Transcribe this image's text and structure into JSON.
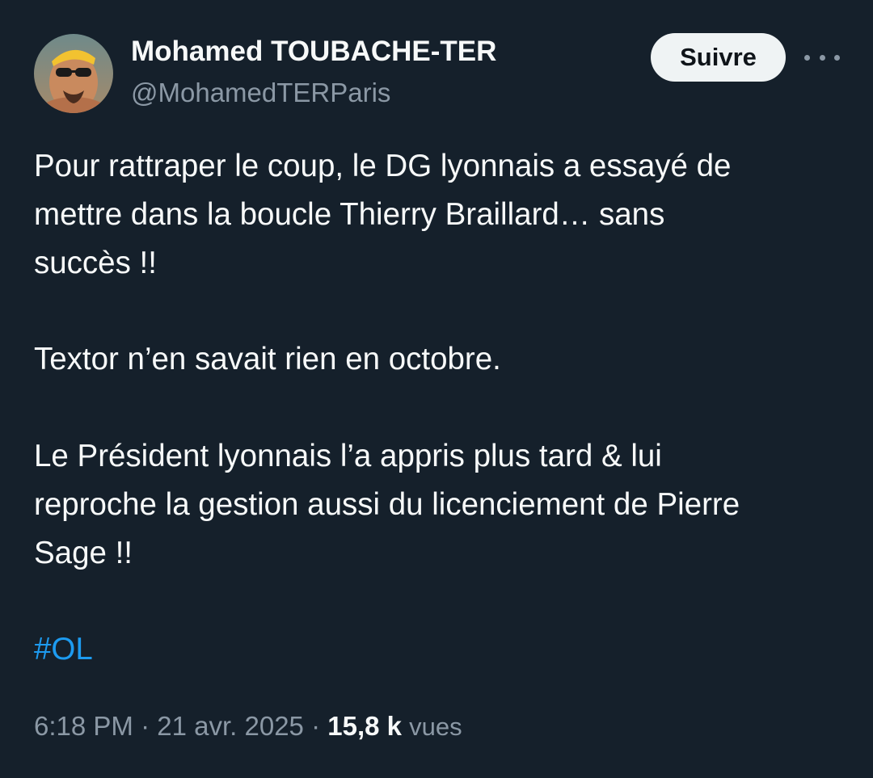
{
  "author": {
    "name": "Mohamed TOUBACHE-TER",
    "handle": "@MohamedTERParis"
  },
  "follow_label": "Suivre",
  "more_icon": "more-horizontal-icon",
  "tweet": {
    "lines": [
      "Pour rattraper le coup, le DG lyonnais a essayé de",
      "mettre dans la boucle Thierry Braillard… sans",
      "succès !!",
      "Textor n’en savait rien en octobre.",
      "Le Président lyonnais l’a appris plus tard & lui",
      "reproche la gestion aussi du licenciement de Pierre",
      "Sage !!"
    ],
    "hashtag": "#OL"
  },
  "meta": {
    "time": "6:18 PM",
    "sep1": "·",
    "date": "21 avr. 2025",
    "sep2": "·",
    "views_count": "15,8 k",
    "views_label": "vues"
  },
  "colors": {
    "background": "#15202b",
    "text": "#f7f9f9",
    "muted": "#8b98a5",
    "link": "#1d9bf0",
    "button_bg": "#eff3f4"
  }
}
